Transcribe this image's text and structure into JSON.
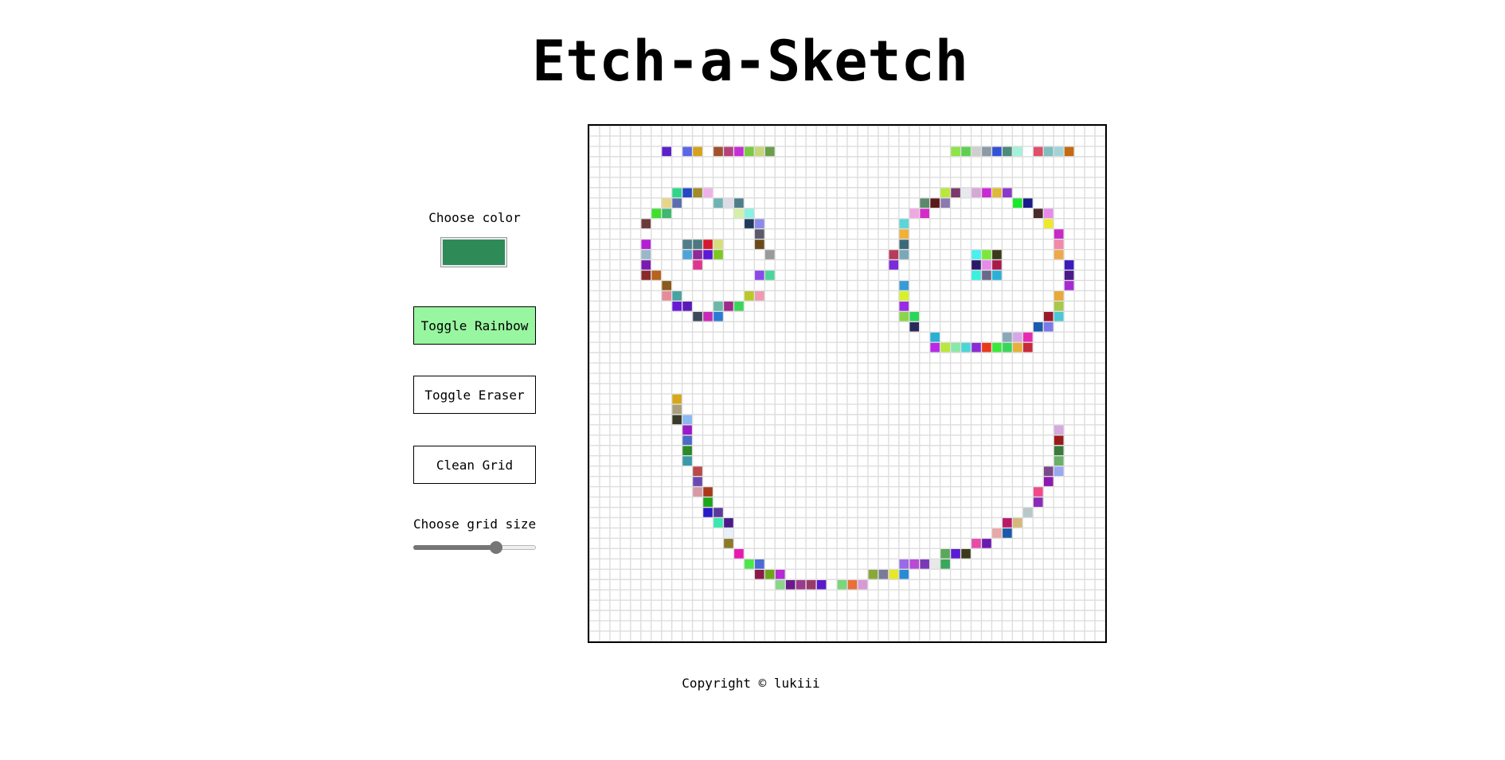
{
  "title": "Etch-a-Sketch",
  "controls": {
    "color_label": "Choose color",
    "selected_color": "#2e8b57",
    "rainbow_button": "Toggle Rainbow",
    "rainbow_active_color": "#98f5a0",
    "eraser_button": "Toggle Eraser",
    "clean_button": "Clean Grid",
    "grid_size_label": "Choose grid size",
    "grid_size_slider": {
      "min": 1,
      "max": 100,
      "value": 70
    }
  },
  "grid": {
    "size": 50,
    "line_color": "#dddddd",
    "painted_cells": [
      [
        7,
        2,
        "#5b21c9"
      ],
      [
        9,
        2,
        "#5a67e6"
      ],
      [
        10,
        2,
        "#d6a21c"
      ],
      [
        12,
        2,
        "#a0522d"
      ],
      [
        13,
        2,
        "#b5427e"
      ],
      [
        14,
        2,
        "#c42fd6"
      ],
      [
        15,
        2,
        "#7ac943"
      ],
      [
        16,
        2,
        "#c7d67a"
      ],
      [
        17,
        2,
        "#6a9f4a"
      ],
      [
        35,
        2,
        "#8ee34a"
      ],
      [
        36,
        2,
        "#5dd14f"
      ],
      [
        37,
        2,
        "#cfcfcf"
      ],
      [
        38,
        2,
        "#8a9aa8"
      ],
      [
        39,
        2,
        "#3452d6"
      ],
      [
        40,
        2,
        "#4c8a7a"
      ],
      [
        41,
        2,
        "#a2f2dc"
      ],
      [
        43,
        2,
        "#e0506a"
      ],
      [
        44,
        2,
        "#7fbfbf"
      ],
      [
        45,
        2,
        "#a3d3d6"
      ],
      [
        46,
        2,
        "#c46a12"
      ],
      [
        8,
        6,
        "#2fd68a"
      ],
      [
        9,
        6,
        "#2348c7"
      ],
      [
        10,
        6,
        "#9f8c2a"
      ],
      [
        11,
        6,
        "#efb2e8"
      ],
      [
        7,
        7,
        "#e8d58a"
      ],
      [
        8,
        7,
        "#5b6fb0"
      ],
      [
        12,
        7,
        "#6fb3b3"
      ],
      [
        13,
        7,
        "#dcdce8"
      ],
      [
        14,
        7,
        "#4e7d8a"
      ],
      [
        6,
        8,
        "#3fe02c"
      ],
      [
        7,
        8,
        "#3fb870"
      ],
      [
        14,
        8,
        "#d4f0a8"
      ],
      [
        15,
        8,
        "#8af2e0"
      ],
      [
        5,
        9,
        "#6b3a3a"
      ],
      [
        15,
        9,
        "#1f3b5c"
      ],
      [
        16,
        9,
        "#8a8aea"
      ],
      [
        16,
        10,
        "#5a5a6a"
      ],
      [
        5,
        11,
        "#b41ed6"
      ],
      [
        9,
        11,
        "#4f7d8a"
      ],
      [
        10,
        11,
        "#4a7a80"
      ],
      [
        11,
        11,
        "#d6182f"
      ],
      [
        12,
        11,
        "#d6e07a"
      ],
      [
        16,
        11,
        "#6b4a1a"
      ],
      [
        5,
        12,
        "#9ab8c8"
      ],
      [
        9,
        12,
        "#4fa3d6"
      ],
      [
        10,
        12,
        "#8f2a9a"
      ],
      [
        11,
        12,
        "#5a1ad6"
      ],
      [
        12,
        12,
        "#7ac91e"
      ],
      [
        17,
        12,
        "#9a9a9a"
      ],
      [
        5,
        13,
        "#7a1ab0"
      ],
      [
        10,
        13,
        "#e0358f"
      ],
      [
        5,
        14,
        "#8a2a2a"
      ],
      [
        6,
        14,
        "#b8621e"
      ],
      [
        16,
        14,
        "#8a4ae8"
      ],
      [
        17,
        14,
        "#4ad69a"
      ],
      [
        7,
        15,
        "#8a5a1e"
      ],
      [
        7,
        16,
        "#e88a9a"
      ],
      [
        8,
        16,
        "#4aa3a3"
      ],
      [
        15,
        16,
        "#b8c82a"
      ],
      [
        16,
        16,
        "#f09ab0"
      ],
      [
        8,
        17,
        "#6a1ad6"
      ],
      [
        9,
        17,
        "#5a1ab8"
      ],
      [
        12,
        17,
        "#6ab8a8"
      ],
      [
        13,
        17,
        "#a02a8a"
      ],
      [
        14,
        17,
        "#3ad65a"
      ],
      [
        10,
        18,
        "#3a4a5a"
      ],
      [
        11,
        18,
        "#c82ab8"
      ],
      [
        12,
        18,
        "#2a7ad6"
      ],
      [
        34,
        6,
        "#b8e83a"
      ],
      [
        35,
        6,
        "#7a3a6a"
      ],
      [
        36,
        6,
        "#e8e8f0"
      ],
      [
        37,
        6,
        "#d6a8d6"
      ],
      [
        38,
        6,
        "#c82ad6"
      ],
      [
        39,
        6,
        "#e0b83a"
      ],
      [
        40,
        6,
        "#8a3ac8"
      ],
      [
        32,
        7,
        "#5a8a6a"
      ],
      [
        33,
        7,
        "#5a1a1a"
      ],
      [
        34,
        7,
        "#8a7ab0"
      ],
      [
        41,
        7,
        "#1ae82a"
      ],
      [
        42,
        7,
        "#1a1a8a"
      ],
      [
        31,
        8,
        "#f0a8e0"
      ],
      [
        32,
        8,
        "#d62ac8"
      ],
      [
        43,
        8,
        "#4a2a2a"
      ],
      [
        44,
        8,
        "#e88ae8"
      ],
      [
        30,
        9,
        "#5ad6d6"
      ],
      [
        44,
        9,
        "#f0e82a"
      ],
      [
        30,
        10,
        "#f0b03a"
      ],
      [
        45,
        10,
        "#c82ac8"
      ],
      [
        30,
        11,
        "#3a6a7a"
      ],
      [
        45,
        11,
        "#f08aa8"
      ],
      [
        29,
        12,
        "#b83a5a"
      ],
      [
        30,
        12,
        "#7aa8b8"
      ],
      [
        37,
        12,
        "#4af0f0"
      ],
      [
        38,
        12,
        "#7ae83a"
      ],
      [
        39,
        12,
        "#3a3a1a"
      ],
      [
        45,
        12,
        "#f0a84a"
      ],
      [
        29,
        13,
        "#7a2ad6"
      ],
      [
        37,
        13,
        "#2a1a6a"
      ],
      [
        38,
        13,
        "#e88ae8"
      ],
      [
        39,
        13,
        "#a81a4a"
      ],
      [
        46,
        13,
        "#3a1ab8"
      ],
      [
        37,
        14,
        "#3af0e0"
      ],
      [
        38,
        14,
        "#6a6a8a"
      ],
      [
        39,
        14,
        "#2ab0d6"
      ],
      [
        46,
        14,
        "#4a1a8a"
      ],
      [
        30,
        15,
        "#3a9ad6"
      ],
      [
        46,
        15,
        "#a82ad6"
      ],
      [
        30,
        16,
        "#d6f02a"
      ],
      [
        45,
        16,
        "#e8a83a"
      ],
      [
        30,
        17,
        "#9a2ae8"
      ],
      [
        45,
        17,
        "#a8c84a"
      ],
      [
        30,
        18,
        "#8ad64a"
      ],
      [
        31,
        18,
        "#2ad65a"
      ],
      [
        44,
        18,
        "#9a1a2a"
      ],
      [
        45,
        18,
        "#4ac8d6"
      ],
      [
        31,
        19,
        "#2a2a5a"
      ],
      [
        43,
        19,
        "#1a5ab0"
      ],
      [
        44,
        19,
        "#7a7ae8"
      ],
      [
        33,
        20,
        "#2ab0d6"
      ],
      [
        40,
        20,
        "#8aa8b8"
      ],
      [
        41,
        20,
        "#d6a8e8"
      ],
      [
        42,
        20,
        "#e82ab0"
      ],
      [
        33,
        21,
        "#b82ae8"
      ],
      [
        34,
        21,
        "#b8e83a"
      ],
      [
        35,
        21,
        "#8ae8a8"
      ],
      [
        36,
        21,
        "#4ad6d6"
      ],
      [
        37,
        21,
        "#8a2ad6"
      ],
      [
        38,
        21,
        "#e83a1a"
      ],
      [
        39,
        21,
        "#3ae83a"
      ],
      [
        40,
        21,
        "#3ad65a"
      ],
      [
        41,
        21,
        "#e8b03a"
      ],
      [
        42,
        21,
        "#c82a3a"
      ],
      [
        8,
        26,
        "#d6a81a"
      ],
      [
        8,
        27,
        "#a8a07a"
      ],
      [
        8,
        28,
        "#3a3a2a"
      ],
      [
        9,
        28,
        "#8ab8f0"
      ],
      [
        9,
        29,
        "#9a1ac8"
      ],
      [
        45,
        29,
        "#d6a8e0"
      ],
      [
        9,
        30,
        "#4a6ac8"
      ],
      [
        45,
        30,
        "#9a1a1a"
      ],
      [
        9,
        31,
        "#2a8a2a"
      ],
      [
        45,
        31,
        "#3a7a3a"
      ],
      [
        9,
        32,
        "#3a9aa8"
      ],
      [
        45,
        32,
        "#6ab06a"
      ],
      [
        10,
        33,
        "#b84a4a"
      ],
      [
        44,
        33,
        "#7a4a8a"
      ],
      [
        45,
        33,
        "#9aa8f0"
      ],
      [
        10,
        34,
        "#6a4ab0"
      ],
      [
        44,
        34,
        "#8a1ab0"
      ],
      [
        10,
        35,
        "#d69aa8"
      ],
      [
        11,
        35,
        "#a83a1a"
      ],
      [
        43,
        35,
        "#f04a8a"
      ],
      [
        11,
        36,
        "#1aa81a"
      ],
      [
        43,
        36,
        "#8a2ab8"
      ],
      [
        11,
        37,
        "#2a1ac8"
      ],
      [
        12,
        37,
        "#5a3a9a"
      ],
      [
        42,
        37,
        "#b8c8c8"
      ],
      [
        12,
        38,
        "#3ae8b0"
      ],
      [
        13,
        38,
        "#4a1a8a"
      ],
      [
        40,
        38,
        "#b81a6a"
      ],
      [
        41,
        38,
        "#d6b87a"
      ],
      [
        13,
        39,
        "#e8f0f8"
      ],
      [
        39,
        39,
        "#e8a8a8"
      ],
      [
        40,
        39,
        "#1a5aa8"
      ],
      [
        13,
        40,
        "#8a7a2a"
      ],
      [
        37,
        40,
        "#e84aa8"
      ],
      [
        38,
        40,
        "#6a1ab0"
      ],
      [
        14,
        41,
        "#e81ab0"
      ],
      [
        34,
        41,
        "#5aa85a"
      ],
      [
        35,
        41,
        "#5a1ad6"
      ],
      [
        36,
        41,
        "#3a3a1a"
      ],
      [
        15,
        42,
        "#4ae84a"
      ],
      [
        16,
        42,
        "#4a6ad6"
      ],
      [
        30,
        42,
        "#9a6ae8"
      ],
      [
        31,
        42,
        "#b84ad6"
      ],
      [
        32,
        42,
        "#7a3ab8"
      ],
      [
        33,
        42,
        "#e8e8e8"
      ],
      [
        34,
        42,
        "#3aa85a"
      ],
      [
        16,
        43,
        "#8a1a4a"
      ],
      [
        17,
        43,
        "#6aa81a"
      ],
      [
        18,
        43,
        "#b82ad6"
      ],
      [
        27,
        43,
        "#8aa83a"
      ],
      [
        28,
        43,
        "#7a7a9a"
      ],
      [
        29,
        43,
        "#e8e82a"
      ],
      [
        30,
        43,
        "#2a8ad6"
      ],
      [
        18,
        44,
        "#8ad68a"
      ],
      [
        19,
        44,
        "#6a1a8a"
      ],
      [
        20,
        44,
        "#9a3a8a"
      ],
      [
        21,
        44,
        "#9a3a6a"
      ],
      [
        22,
        44,
        "#5a1ac8"
      ],
      [
        24,
        44,
        "#7ad67a"
      ],
      [
        25,
        44,
        "#e8703a"
      ],
      [
        26,
        44,
        "#d69ad6"
      ]
    ]
  },
  "footer": "Copyright © lukiii"
}
